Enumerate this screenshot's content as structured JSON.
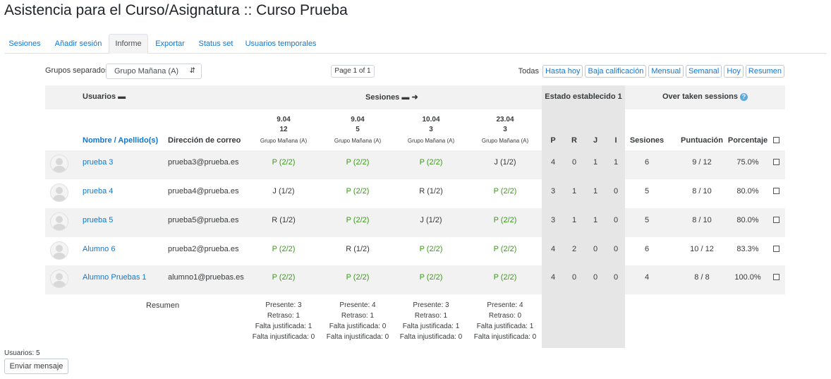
{
  "page": {
    "title": "Asistencia para el Curso/Asignatura :: Curso Prueba"
  },
  "tabs": [
    "Sesiones",
    "Añadir sesión",
    "Informe",
    "Exportar",
    "Status set",
    "Usuarios temporales"
  ],
  "controls": {
    "group_label": "Grupos separados",
    "group_value": "Grupo Mañana (A)",
    "page_indicator": "Page 1 of 1",
    "todas_label": "Todas",
    "filters": [
      "Hasta hoy",
      "Baja calificación",
      "Mensual",
      "Semanal",
      "Hoy",
      "Resumen"
    ]
  },
  "table": {
    "usuarios_header": "Usuarios",
    "sesiones_header": "Sesiones",
    "estado_header": "Estado establecido 1",
    "over_header": "Over taken sessions",
    "name_col": "Nombre / Apellido(s)",
    "email_col": "Dirección de correo",
    "sessions": [
      {
        "date": "9.04",
        "num": "12",
        "group": "Grupo Mañana (A)"
      },
      {
        "date": "9.04",
        "num": "5",
        "group": "Grupo Mañana (A)"
      },
      {
        "date": "10.04",
        "num": "3",
        "group": "Grupo Mañana (A)"
      },
      {
        "date": "23.04",
        "num": "3",
        "group": "Grupo Mañana (A)"
      }
    ],
    "status_cols": [
      "P",
      "R",
      "J",
      "I"
    ],
    "over_cols": [
      "Sesiones",
      "Puntuación",
      "Porcentaje"
    ],
    "rows": [
      {
        "name": "prueba 3",
        "email": "prueba3@prueba.es",
        "s": [
          "P (2/2)",
          "P (2/2)",
          "P (2/2)",
          "J (1/2)"
        ],
        "st": [
          "4",
          "0",
          "1",
          "1"
        ],
        "sesiones": "6",
        "puntuacion": "9 / 12",
        "porcentaje": "75.0%"
      },
      {
        "name": "prueba 4",
        "email": "prueba4@prueba.es",
        "s": [
          "J (1/2)",
          "P (2/2)",
          "R (1/2)",
          "P (2/2)"
        ],
        "st": [
          "3",
          "1",
          "1",
          "0"
        ],
        "sesiones": "5",
        "puntuacion": "8 / 10",
        "porcentaje": "80.0%"
      },
      {
        "name": "prueba 5",
        "email": "prueba5@prueba.es",
        "s": [
          "R (1/2)",
          "P (2/2)",
          "J (1/2)",
          "P (2/2)"
        ],
        "st": [
          "3",
          "1",
          "1",
          "0"
        ],
        "sesiones": "5",
        "puntuacion": "8 / 10",
        "porcentaje": "80.0%"
      },
      {
        "name": "Alumno 6",
        "email": "prueba2@prueba.es",
        "s": [
          "P (2/2)",
          "R (1/2)",
          "P (2/2)",
          "P (2/2)"
        ],
        "st": [
          "4",
          "2",
          "0",
          "0"
        ],
        "sesiones": "6",
        "puntuacion": "10 / 12",
        "porcentaje": "83.3%"
      },
      {
        "name": "Alumno Pruebas 1",
        "email": "alumno1@pruebas.es",
        "s": [
          "P (2/2)",
          "P (2/2)",
          "P (2/2)",
          "P (2/2)"
        ],
        "st": [
          "4",
          "0",
          "0",
          "0"
        ],
        "sesiones": "4",
        "puntuacion": "8 / 8",
        "porcentaje": "100.0%"
      }
    ],
    "summary_label": "Resumen",
    "summary": [
      [
        "Presente: 3",
        "Retraso: 1",
        "Falta justificada: 1",
        "Falta injustificada: 0"
      ],
      [
        "Presente: 4",
        "Retraso: 1",
        "Falta justificada: 0",
        "Falta injustificada: 0"
      ],
      [
        "Presente: 3",
        "Retraso: 1",
        "Falta justificada: 1",
        "Falta injustificada: 0"
      ],
      [
        "Presente: 4",
        "Retraso: 0",
        "Falta justificada: 1",
        "Falta injustificada: 0"
      ]
    ]
  },
  "footer": {
    "users_count": "Usuarios: 5",
    "send_button": "Enviar mensaje"
  },
  "colors": {
    "link": "#1177d1",
    "present": "#3c9a1b",
    "stripe": "#f2f2f2",
    "stat_column": "#e6e6e6"
  }
}
